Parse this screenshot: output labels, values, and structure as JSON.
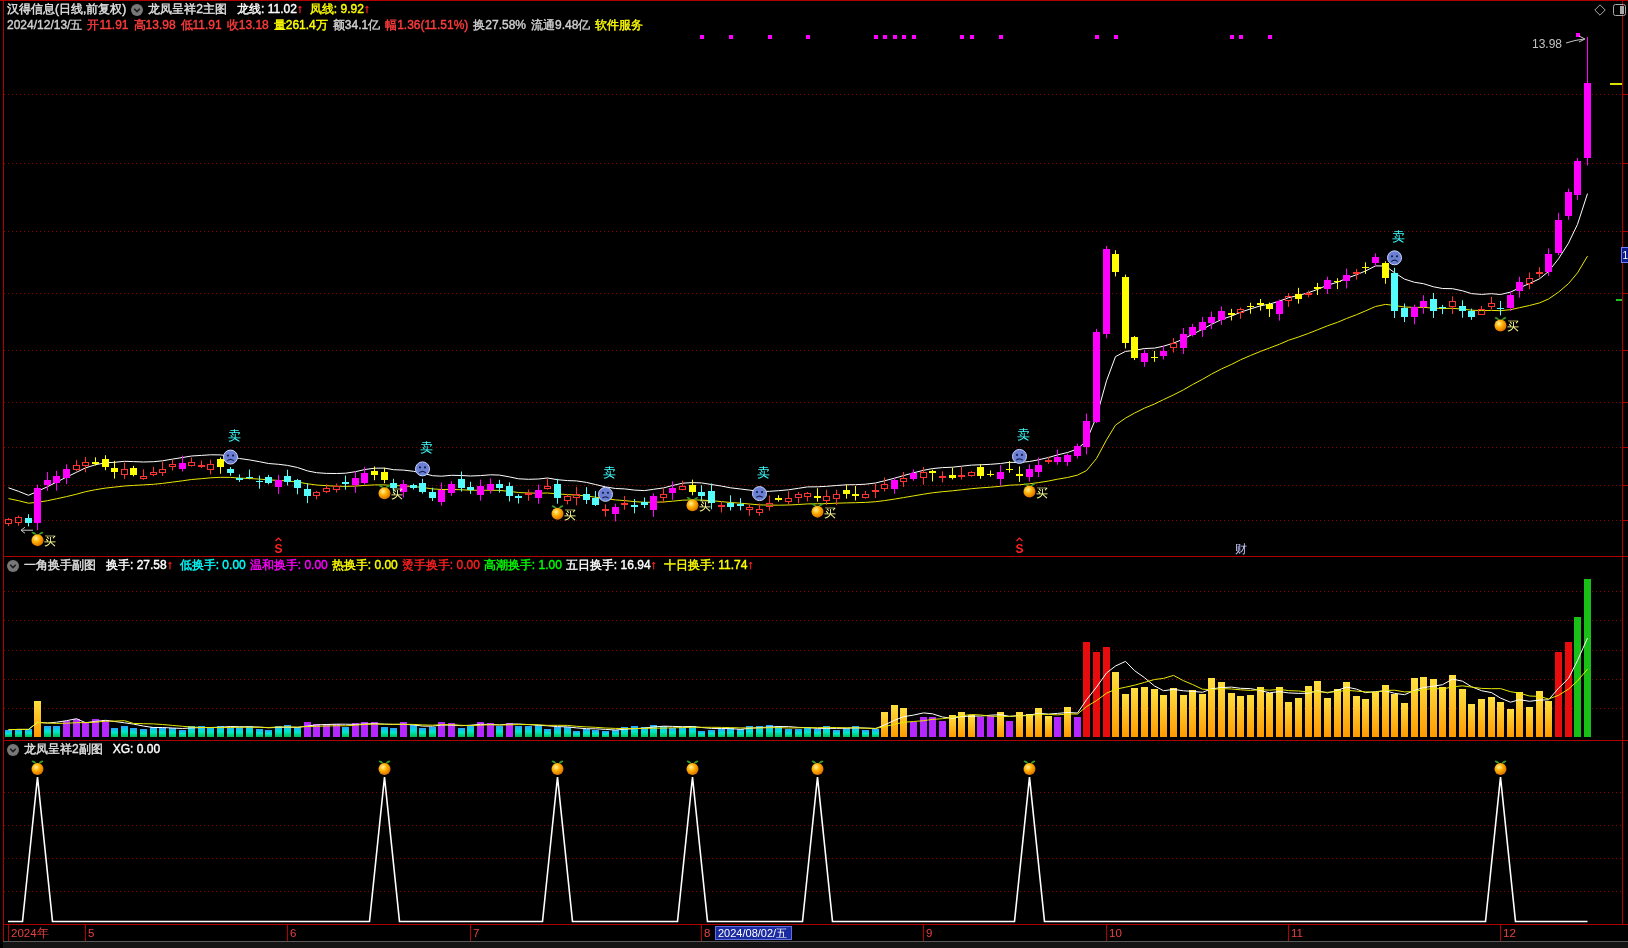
{
  "main_panel": {
    "title": "汉得信息(日线,前复权)",
    "indicator": "龙凤呈祥2主图",
    "readouts": [
      {
        "label": "龙线: 11.02",
        "arrow": "↑",
        "color": "#ffffff"
      },
      {
        "label": "凤线: 9.92",
        "arrow": "↑",
        "color": "#ffff00"
      }
    ],
    "quote": [
      {
        "text": "2024/12/13/五",
        "color": "#d0d0d0"
      },
      {
        "text": "开11.91",
        "color": "#ff3c3c"
      },
      {
        "text": "高13.98",
        "color": "#ff3c3c"
      },
      {
        "text": "低11.91",
        "color": "#ff3c3c"
      },
      {
        "text": "收13.18",
        "color": "#ff3c3c"
      },
      {
        "text": "量261.4万",
        "color": "#ffff00"
      },
      {
        "text": "额34.1亿",
        "color": "#d0d0d0"
      },
      {
        "text": "幅1.36(11.51%)",
        "color": "#ff3c3c"
      },
      {
        "text": "换27.58%",
        "color": "#d0d0d0"
      },
      {
        "text": "流通9.48亿",
        "color": "#d0d0d0"
      },
      {
        "text": "软件服务",
        "color": "#ffff00"
      }
    ],
    "high_label": "13.98",
    "price_tag": "1",
    "signals": [
      {
        "kind": "buy",
        "label": "买"
      },
      {
        "kind": "sell",
        "label": "卖"
      },
      {
        "kind": "buy",
        "label": "买"
      },
      {
        "kind": "sell",
        "label": "卖"
      },
      {
        "kind": "buy",
        "label": "买"
      },
      {
        "kind": "sell",
        "label": "卖"
      },
      {
        "kind": "buy",
        "label": "买"
      },
      {
        "kind": "sell",
        "label": "卖"
      },
      {
        "kind": "buy",
        "label": "买"
      },
      {
        "kind": "sell",
        "label": "卖"
      },
      {
        "kind": "buy",
        "label": "买"
      },
      {
        "kind": "sell",
        "label": "卖"
      },
      {
        "kind": "buy",
        "label": "买"
      }
    ],
    "events": [
      {
        "kind": "flag",
        "label": "S"
      },
      {
        "kind": "flag",
        "label": "S"
      },
      {
        "kind": "note",
        "label": "财"
      }
    ]
  },
  "turnover_panel": {
    "title": "一角换手副图",
    "readouts": [
      {
        "label": "换手: 27.58",
        "arrow": "↑",
        "color": "#ffffff"
      },
      {
        "label": "低换手: 0.00",
        "color": "#00ffff"
      },
      {
        "label": "温和换手: 0.00",
        "color": "#ff00ff"
      },
      {
        "label": "热换手: 0.00",
        "color": "#ffff00"
      },
      {
        "label": "烫手换手: 0.00",
        "color": "#ff2020"
      },
      {
        "label": "高潮换手: 1.00",
        "color": "#00ff00"
      },
      {
        "label": "五日换手: 16.94",
        "arrow": "↑",
        "color": "#ffffff"
      },
      {
        "label": "十日换手: 11.74",
        "arrow": "↑",
        "color": "#ffff00"
      }
    ]
  },
  "xg_panel": {
    "title": "龙凤呈祥2副图",
    "readouts": [
      {
        "label": "XG: 0.00",
        "color": "#ffffff"
      }
    ]
  },
  "date_axis": {
    "ticks": [
      {
        "label": "2024年"
      },
      {
        "label": "5"
      },
      {
        "label": "6"
      },
      {
        "label": "7"
      },
      {
        "label": "8"
      },
      {
        "label": "9"
      },
      {
        "label": "10"
      },
      {
        "label": "11"
      },
      {
        "label": "12"
      }
    ],
    "cursor_date": "2024/08/02/五"
  }
}
